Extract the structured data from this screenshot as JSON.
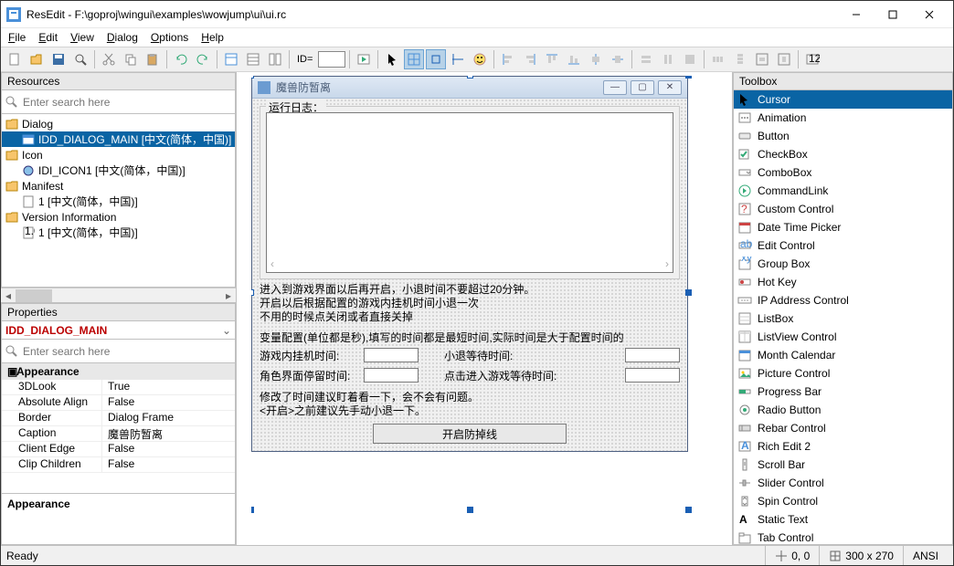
{
  "window": {
    "title": "ResEdit - F:\\goproj\\wingui\\examples\\wowjump\\ui\\ui.rc"
  },
  "menu": {
    "file": "File",
    "edit": "Edit",
    "view": "View",
    "dialog": "Dialog",
    "options": "Options",
    "help": "Help"
  },
  "toolbar": {
    "id_label": "ID="
  },
  "panels": {
    "resources": {
      "title": "Resources",
      "search_ph": "Enter search here"
    },
    "properties": {
      "title": "Properties",
      "search_ph": "Enter search here",
      "selected": "IDD_DIALOG_MAIN",
      "desc": "Appearance"
    },
    "toolbox": {
      "title": "Toolbox"
    }
  },
  "tree": {
    "dialog": {
      "label": "Dialog",
      "items": [
        "IDD_DIALOG_MAIN [中文(简体，中国)]"
      ]
    },
    "icon": {
      "label": "Icon",
      "items": [
        "IDI_ICON1 [中文(简体，中国)]"
      ]
    },
    "manifest": {
      "label": "Manifest",
      "items": [
        "1 [中文(简体，中国)]"
      ]
    },
    "version": {
      "label": "Version Information",
      "items": [
        "1 [中文(简体，中国)]"
      ]
    }
  },
  "props": {
    "cat": "Appearance",
    "rows": [
      {
        "k": "3DLook",
        "v": "True"
      },
      {
        "k": "Absolute Align",
        "v": "False"
      },
      {
        "k": "Border",
        "v": "Dialog Frame"
      },
      {
        "k": "Caption",
        "v": "魔兽防暂离"
      },
      {
        "k": "Client Edge",
        "v": "False"
      },
      {
        "k": "Clip Children",
        "v": "False"
      }
    ]
  },
  "dialog": {
    "caption": "魔兽防暂离",
    "log_label": "运行日志：",
    "info1": "进入到游戏界面以后再开启，小退时间不要超过20分钟。",
    "info2": "开启以后根据配置的游戏内挂机时间小退一次",
    "info3": "不用的时候点关闭或者直接关掉",
    "info4": "变量配置(单位都是秒),填写的时间都是最短时间,实际时间是大于配置时间的",
    "f1": "游戏内挂机时间:",
    "f2": "小退等待时间:",
    "f3": "角色界面停留时间:",
    "f4": "点击进入游戏等待时间:",
    "info5": "修改了时间建议盯着看一下，会不会有问题。",
    "info6": "<开启>之前建议先手动小退一下。",
    "button": "开启防掉线"
  },
  "toolbox": [
    "Cursor",
    "Animation",
    "Button",
    "CheckBox",
    "ComboBox",
    "CommandLink",
    "Custom Control",
    "Date Time Picker",
    "Edit Control",
    "Group Box",
    "Hot Key",
    "IP Address Control",
    "ListBox",
    "ListView Control",
    "Month Calendar",
    "Picture Control",
    "Progress Bar",
    "Radio Button",
    "Rebar Control",
    "Rich Edit 2",
    "Scroll Bar",
    "Slider Control",
    "Spin Control",
    "Static Text",
    "Tab Control"
  ],
  "status": {
    "ready": "Ready",
    "pos": "0, 0",
    "size": "300 x 270",
    "enc": "ANSI"
  }
}
